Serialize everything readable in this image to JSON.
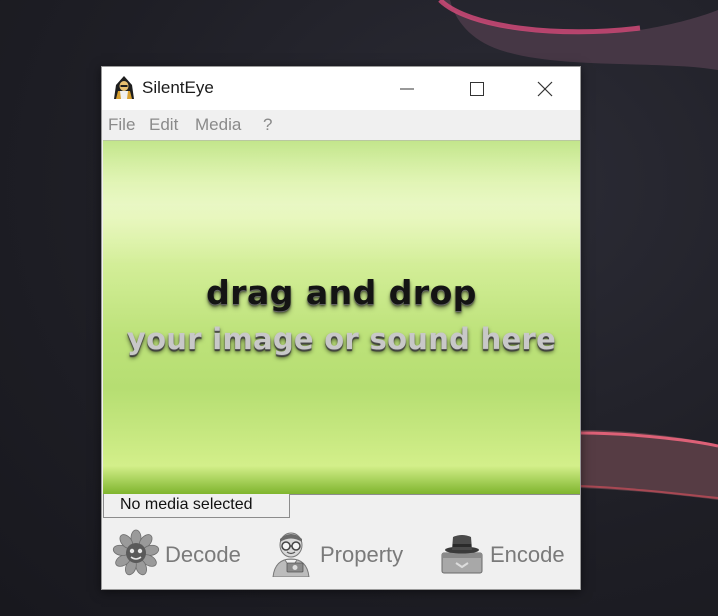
{
  "window": {
    "title": "SilentEye"
  },
  "menu": {
    "items": [
      "File",
      "Edit",
      "Media",
      "?"
    ]
  },
  "dropzone": {
    "line1": "drag and drop",
    "line2": "your image or sound here"
  },
  "status": {
    "text": "No media selected"
  },
  "actions": {
    "decode": "Decode",
    "property": "Property",
    "encode": "Encode"
  },
  "icons": {
    "app": "silenteye-hooded-figure-icon",
    "minimize": "minimize-icon",
    "maximize": "maximize-icon",
    "close": "close-icon",
    "decode": "sunflower-icon",
    "property": "man-with-glasses-icon",
    "encode": "hat-on-box-icon"
  },
  "colors": {
    "dropzone_green": "#c3e68c",
    "desktop_accent": "#c8466a"
  }
}
